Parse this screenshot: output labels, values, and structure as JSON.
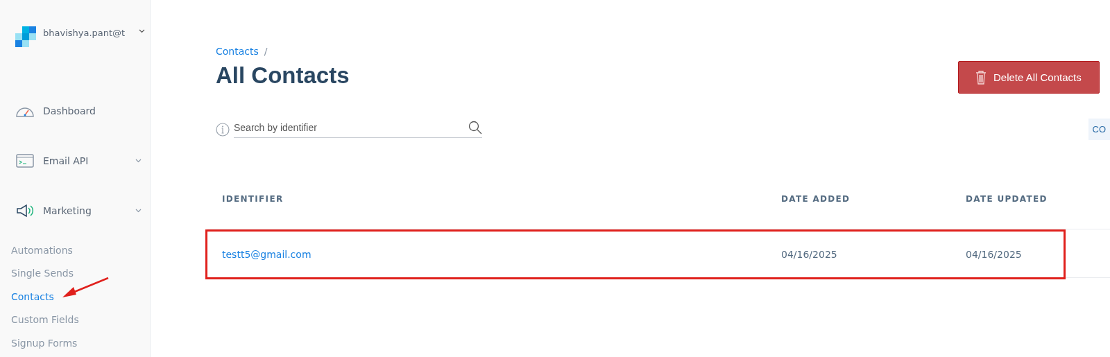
{
  "account": {
    "name": "bhavishya.pant@t"
  },
  "nav": [
    {
      "label": "Dashboard",
      "expandable": false
    },
    {
      "label": "Email API",
      "expandable": true
    },
    {
      "label": "Marketing",
      "expandable": true
    }
  ],
  "subnav": [
    {
      "label": "Automations",
      "selected": false,
      "pointed": false
    },
    {
      "label": "Single Sends",
      "selected": false,
      "pointed": false
    },
    {
      "label": "Contacts",
      "selected": true,
      "pointed": true
    },
    {
      "label": "Custom Fields",
      "selected": false,
      "pointed": false
    },
    {
      "label": "Signup Forms",
      "selected": false,
      "pointed": false
    }
  ],
  "breadcrumb": [
    "Contacts",
    "/"
  ],
  "title": "All Contacts",
  "delete_button": "Delete All Contacts",
  "search": {
    "placeholder": "Search by identifier"
  },
  "side_chip": "CO",
  "table": {
    "columns": [
      "IDENTIFIER",
      "DATE ADDED",
      "DATE UPDATED"
    ],
    "rows": [
      {
        "identifier": "testt5@gmail.com",
        "date_added": "04/16/2025",
        "date_updated": "04/16/2025",
        "highlighted": true
      }
    ]
  }
}
